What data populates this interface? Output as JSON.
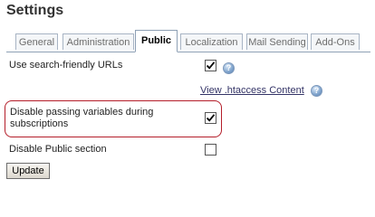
{
  "page": {
    "title": "Settings"
  },
  "tabs": [
    {
      "label": "General"
    },
    {
      "label": "Administration"
    },
    {
      "label": "Public"
    },
    {
      "label": "Localization"
    },
    {
      "label": "Mail Sending"
    },
    {
      "label": "Add-Ons"
    }
  ],
  "active_tab": "Public",
  "settings": {
    "search_friendly": {
      "label": "Use search-friendly URLs",
      "checked": true
    },
    "htaccess_link": {
      "label": "View .htaccess Content"
    },
    "disable_passing": {
      "label_line1": "Disable passing variables during",
      "label_line2": "subscriptions",
      "checked": true
    },
    "disable_public": {
      "label": "Disable Public section",
      "checked": false
    }
  },
  "buttons": {
    "update_label": "Update"
  },
  "help_icon": {
    "glyph": "?",
    "icon": "help-icon"
  },
  "colors": {
    "highlight_border": "#b41e2a",
    "tab_border": "#8ea0b5",
    "link": "#333366"
  }
}
